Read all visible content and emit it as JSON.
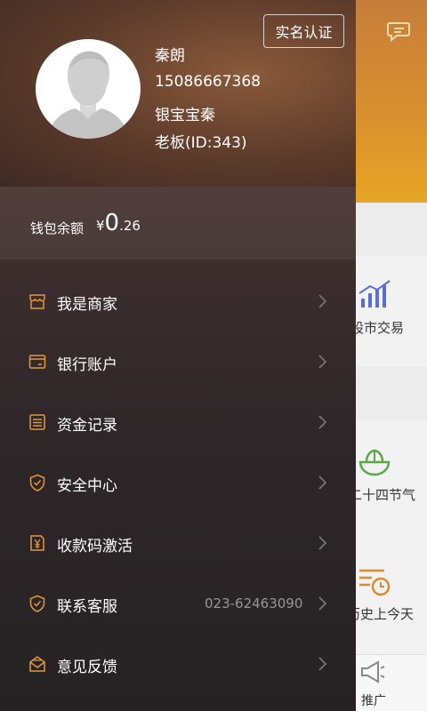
{
  "profile": {
    "name": "秦朗",
    "phone": "15086667368",
    "nickname": "银宝宝秦",
    "role": "老板(ID:343)",
    "verify_label": "实名认证"
  },
  "wallet": {
    "label": "钱包余额",
    "currency": "¥",
    "int_part": "0",
    "dec_part": ".26"
  },
  "menu": [
    {
      "label": "我是商家",
      "icon": "store-icon"
    },
    {
      "label": "银行账户",
      "icon": "bank-card-icon"
    },
    {
      "label": "资金记录",
      "icon": "list-icon"
    },
    {
      "label": "安全中心",
      "icon": "shield-check-icon"
    },
    {
      "label": "收款码激活",
      "icon": "qr-yuan-icon"
    },
    {
      "label": "联系客服",
      "icon": "shield-phone-icon",
      "extra": "023-62463090"
    },
    {
      "label": "意见反馈",
      "icon": "feedback-mail-icon"
    }
  ],
  "background_app": {
    "items": [
      "股市交易",
      "二十四节气",
      "历史上今天",
      "推广"
    ]
  },
  "colors": {
    "accent": "#e39a3a",
    "header": "#d9922e",
    "icon_blue": "#5b6fd1",
    "icon_green": "#5aa84a"
  }
}
